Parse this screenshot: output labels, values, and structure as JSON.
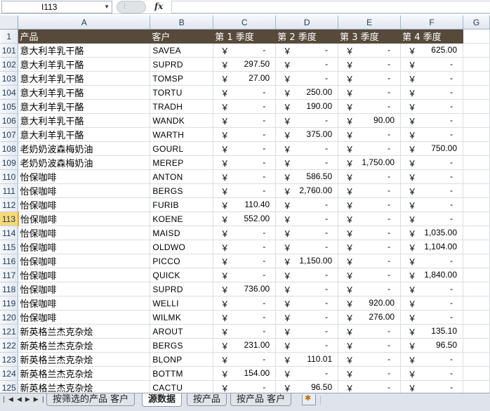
{
  "name_box": "I113",
  "fx_label": "fx",
  "columns": [
    "A",
    "B",
    "C",
    "D",
    "E",
    "F",
    "G"
  ],
  "header_row": {
    "num": "1",
    "cells": [
      "产品",
      "客户",
      "第 1 季度",
      "第 2 季度",
      "第 3 季度",
      "第 4 季度"
    ]
  },
  "currency_symbol": "￥",
  "rows": [
    {
      "num": "101",
      "product": "意大利羊乳干酪",
      "customer": "SAVEA",
      "q1": "-",
      "q2": "-",
      "q3": "-",
      "q4": "625.00"
    },
    {
      "num": "102",
      "product": "意大利羊乳干酪",
      "customer": "SUPRD",
      "q1": "297.50",
      "q2": "-",
      "q3": "-",
      "q4": "-"
    },
    {
      "num": "103",
      "product": "意大利羊乳干酪",
      "customer": "TOMSP",
      "q1": "27.00",
      "q2": "-",
      "q3": "-",
      "q4": "-"
    },
    {
      "num": "104",
      "product": "意大利羊乳干酪",
      "customer": "TORTU",
      "q1": "-",
      "q2": "250.00",
      "q3": "-",
      "q4": "-"
    },
    {
      "num": "105",
      "product": "意大利羊乳干酪",
      "customer": "TRADH",
      "q1": "-",
      "q2": "190.00",
      "q3": "-",
      "q4": "-"
    },
    {
      "num": "106",
      "product": "意大利羊乳干酪",
      "customer": "WANDK",
      "q1": "-",
      "q2": "-",
      "q3": "90.00",
      "q4": "-"
    },
    {
      "num": "107",
      "product": "意大利羊乳干酪",
      "customer": "WARTH",
      "q1": "-",
      "q2": "375.00",
      "q3": "-",
      "q4": "-"
    },
    {
      "num": "108",
      "product": "老奶奶波森梅奶油",
      "customer": "GOURL",
      "q1": "-",
      "q2": "-",
      "q3": "-",
      "q4": "750.00"
    },
    {
      "num": "109",
      "product": "老奶奶波森梅奶油",
      "customer": "MEREP",
      "q1": "-",
      "q2": "-",
      "q3": "1,750.00",
      "q4": "-"
    },
    {
      "num": "110",
      "product": "怡保咖啡",
      "customer": "ANTON",
      "q1": "-",
      "q2": "586.50",
      "q3": "-",
      "q4": "-"
    },
    {
      "num": "111",
      "product": "怡保咖啡",
      "customer": "BERGS",
      "q1": "-",
      "q2": "2,760.00",
      "q3": "-",
      "q4": "-"
    },
    {
      "num": "112",
      "product": "怡保咖啡",
      "customer": "FURIB",
      "q1": "110.40",
      "q2": "-",
      "q3": "-",
      "q4": "-"
    },
    {
      "num": "113",
      "product": "怡保咖啡",
      "customer": "KOENE",
      "q1": "552.00",
      "q2": "-",
      "q3": "-",
      "q4": "-"
    },
    {
      "num": "114",
      "product": "怡保咖啡",
      "customer": "MAISD",
      "q1": "-",
      "q2": "-",
      "q3": "-",
      "q4": "1,035.00"
    },
    {
      "num": "115",
      "product": "怡保咖啡",
      "customer": "OLDWO",
      "q1": "-",
      "q2": "-",
      "q3": "-",
      "q4": "1,104.00"
    },
    {
      "num": "116",
      "product": "怡保咖啡",
      "customer": "PICCO",
      "q1": "-",
      "q2": "1,150.00",
      "q3": "-",
      "q4": "-"
    },
    {
      "num": "117",
      "product": "怡保咖啡",
      "customer": "QUICK",
      "q1": "-",
      "q2": "-",
      "q3": "-",
      "q4": "1,840.00"
    },
    {
      "num": "118",
      "product": "怡保咖啡",
      "customer": "SUPRD",
      "q1": "736.00",
      "q2": "-",
      "q3": "-",
      "q4": "-"
    },
    {
      "num": "119",
      "product": "怡保咖啡",
      "customer": "WELLI",
      "q1": "-",
      "q2": "-",
      "q3": "920.00",
      "q4": "-"
    },
    {
      "num": "120",
      "product": "怡保咖啡",
      "customer": "WILMK",
      "q1": "-",
      "q2": "-",
      "q3": "276.00",
      "q4": "-"
    },
    {
      "num": "121",
      "product": "新英格兰杰克杂烩",
      "customer": "AROUT",
      "q1": "-",
      "q2": "-",
      "q3": "-",
      "q4": "135.10"
    },
    {
      "num": "122",
      "product": "新英格兰杰克杂烩",
      "customer": "BERGS",
      "q1": "231.00",
      "q2": "-",
      "q3": "-",
      "q4": "96.50"
    },
    {
      "num": "123",
      "product": "新英格兰杰克杂烩",
      "customer": "BLONP",
      "q1": "-",
      "q2": "110.01",
      "q3": "-",
      "q4": "-"
    },
    {
      "num": "124",
      "product": "新英格兰杰克杂烩",
      "customer": "BOTTM",
      "q1": "154.00",
      "q2": "-",
      "q3": "-",
      "q4": "-"
    },
    {
      "num": "125",
      "product": "新英格兰杰克杂烩",
      "customer": "CACTU",
      "q1": "-",
      "q2": "96.50",
      "q3": "-",
      "q4": "-"
    }
  ],
  "sheet_tabs": [
    "按筛选的产品 客户",
    "源数据",
    "按产品",
    "按产品 客户"
  ],
  "active_tab": "源数据",
  "selected_row": "113",
  "colors": {
    "header_fill": "#584a3a",
    "header_text": "#ffffff",
    "selected_row_header": "#f8d878"
  }
}
